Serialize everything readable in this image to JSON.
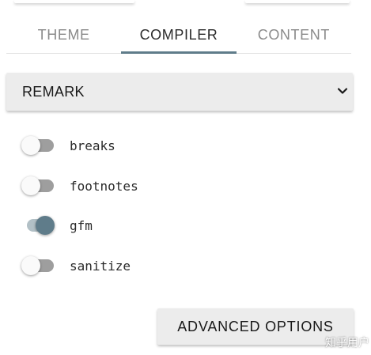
{
  "tabs": [
    {
      "label": "THEME",
      "active": false
    },
    {
      "label": "COMPILER",
      "active": true
    },
    {
      "label": "CONTENT",
      "active": false
    }
  ],
  "compiler_select": {
    "value": "REMARK",
    "icon": "chevron-down-icon"
  },
  "options": [
    {
      "label": "breaks",
      "enabled": false
    },
    {
      "label": "footnotes",
      "enabled": false
    },
    {
      "label": "gfm",
      "enabled": true
    },
    {
      "label": "sanitize",
      "enabled": false
    }
  ],
  "advanced_button": {
    "label": "ADVANCED OPTIONS"
  },
  "watermark": "知乎用户",
  "colors": {
    "accent": "#5f7c8a",
    "toggle_on_track": "#b2c0c6",
    "toggle_off_track": "#9e9e9e",
    "control_bg": "#ececec"
  }
}
